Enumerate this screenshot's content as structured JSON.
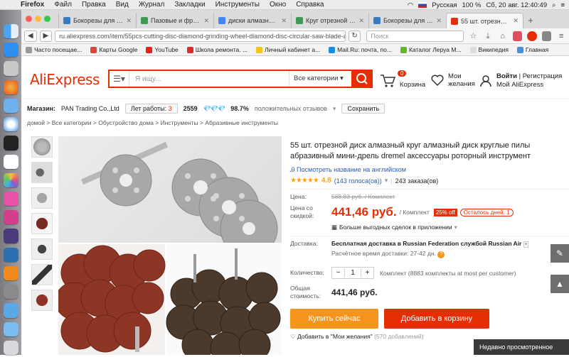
{
  "menubar": {
    "app": "Firefox",
    "items": [
      "Файл",
      "Правка",
      "Вид",
      "Журнал",
      "Закладки",
      "Инструменты",
      "Окно",
      "Справка"
    ],
    "lang": "Русская",
    "battery": "100 %",
    "datetime": "Сб, 20 авг.  12:40:49"
  },
  "tabs": [
    {
      "label": "Бокорезы для стали...",
      "color": "#3a7ac2"
    },
    {
      "label": "Пазовые и фрезерн...",
      "color": "#3e9a52"
    },
    {
      "label": "диски алмазные для ...",
      "color": "#4285f4"
    },
    {
      "label": "Круг отрезной алма...",
      "color": "#3e9a52"
    },
    {
      "label": "Бокорезы для стали...",
      "color": "#3a7ac2"
    },
    {
      "label": "55 шт. отрезной диск...",
      "color": "#e62e04"
    }
  ],
  "nav": {
    "url": "ru.aliexpress.com/item/55pcs-cutting-disc-diamond-grinding-wheel-diamond-disc-circular-saw-blade-abrasive-mi",
    "search_placeholder": "Поиск"
  },
  "bookmarks": [
    "Часто посещае...",
    "Карты Google",
    "YouTube",
    "Школа ремонта. ...",
    "Личный кабинет а...",
    "Mail.Ru: почта, по...",
    "Каталог Леруа М...",
    "Википедия",
    "Главная"
  ],
  "header": {
    "logo": "AliExpress",
    "search_placeholder": "Я ищу...",
    "category": "Все категории",
    "cart_label": "Корзина",
    "cart_count": "0",
    "wish_label": "Мои\nжелания",
    "login": "Войти",
    "register": "Регистрация",
    "account": "Мой AliExpress"
  },
  "store": {
    "label": "Магазин:",
    "name": "PAN Trading Co.,Ltd",
    "years_label": "Лет работы:",
    "years": "3",
    "score": "2559",
    "positive": "98.7%",
    "positive_label": "положительных отзывов",
    "save": "Сохранить"
  },
  "breadcrumbs": "домой  >  Все категории  >  Обустройство дома  >  Инструменты  >  Абразивные инструменты",
  "product": {
    "title": "55 шт. отрезной диск алмазный круг алмазный диск круглые пилы абразивный мини-дрель dremel аксессуары роторный инструмент",
    "translate": "Посмотреть название на английском",
    "rating": "4.8",
    "votes": "(143 голоса(ов))",
    "orders": "243 заказа(ов)",
    "price_label": "Цена:",
    "old_price": "588,83 руб. / Комплект",
    "discount_label": "Цена со скидкой:",
    "new_price": "441,46 руб.",
    "per": "/ Комплект",
    "off": "25% off",
    "days_left": "Осталось дней: 1",
    "app_deals": "Больше выгодных сделок в приложении",
    "delivery_label": "Доставка:",
    "delivery": "Бесплатная доставка в Russian Federation службой Russian Air",
    "delivery_time": "Расчётное время доставки: 27-42 дн.",
    "qty_label": "Количество:",
    "qty": "1",
    "qty_note": "Комплект (8883 комплекты at most per customer)",
    "total_label": "Общая стоимость:",
    "total": "441,46 руб.",
    "buy": "Купить сейчас",
    "add_cart": "Добавить в корзину",
    "add_wish": "Добавить в \"Мои желания\"",
    "wish_count": "(570 добавлений)"
  },
  "recent": "Недавно просмотренное",
  "colors": {
    "accent": "#e62e04",
    "buy": "#f7941d",
    "cart_btn": "#e62e04"
  }
}
